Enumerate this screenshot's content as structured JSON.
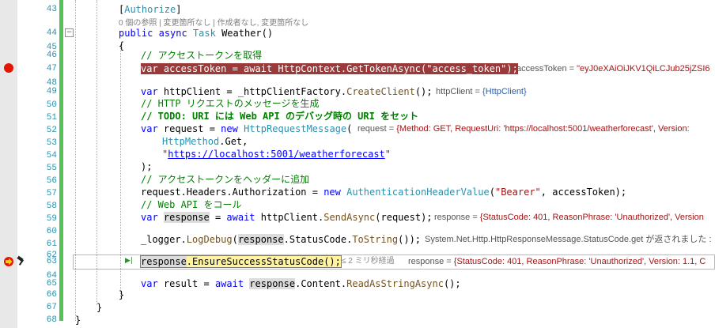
{
  "lens_text": "0 個の参照 | 変更箇所なし | 作成者なし, 変更箇所なし",
  "lines": [
    {
      "n": "43"
    },
    {
      "n": "44"
    },
    {
      "n": "45"
    },
    {
      "n": "46"
    },
    {
      "n": "47"
    },
    {
      "n": "48"
    },
    {
      "n": "49"
    },
    {
      "n": "50"
    },
    {
      "n": "51"
    },
    {
      "n": "52"
    },
    {
      "n": "53"
    },
    {
      "n": "54"
    },
    {
      "n": "55"
    },
    {
      "n": "56"
    },
    {
      "n": "57"
    },
    {
      "n": "58"
    },
    {
      "n": "59"
    },
    {
      "n": "60"
    },
    {
      "n": "61"
    },
    {
      "n": "62"
    },
    {
      "n": "63"
    },
    {
      "n": "64"
    },
    {
      "n": "65"
    },
    {
      "n": "66"
    },
    {
      "n": "67"
    },
    {
      "n": "68"
    }
  ],
  "code": {
    "l43": {
      "a": "[",
      "b": "Authorize",
      "c": "]"
    },
    "l44": {
      "kw1": "public",
      "kw2": "async",
      "ty": "Task",
      "rest": " Weather()"
    },
    "l45": "{",
    "l46": "// アクセストークンを取得",
    "l47": "var accessToken = await HttpContext.GetTokenAsync(\"access_token\");",
    "l49": {
      "kw": "var",
      "a": " httpClient = _httpClientFactory.",
      "m": "CreateClient",
      "b": "();"
    },
    "l50": "// HTTP リクエストのメッセージを生成",
    "l51": "// TODO: URI には Web API のデバッグ時の URI をセット",
    "l52": {
      "kw": "var",
      "a": " request = ",
      "kw2": "new",
      "ty": "HttpRequestMessage",
      "b": "("
    },
    "l53": {
      "ty": "HttpMethod",
      "b": ".Get,"
    },
    "l54": {
      "q1": "\"",
      "url": "https://localhost:5001/weatherforecast",
      "q2": "\""
    },
    "l55": ");",
    "l56": "// アクセストークンをヘッダーに追加",
    "l57": {
      "a": "request.Headers.Authorization = ",
      "kw": "new",
      "ty": "AuthenticationHeaderValue",
      "b": "(",
      "s": "\"Bearer\"",
      "c": ", accessToken);"
    },
    "l58": "// Web API をコール",
    "l59": {
      "kw": "var",
      "sym": "response",
      "a": " = ",
      "kw2": "await",
      "b": " httpClient.",
      "m": "SendAsync",
      "c": "(request);"
    },
    "l61": {
      "a": "_logger.",
      "m": "LogDebug",
      "b": "(",
      "sym": "response",
      "c": ".StatusCode.",
      "m2": "ToString",
      "d": "());"
    },
    "l63": {
      "sym": "response",
      "a": ".",
      "m": "EnsureSuccessStatusCode",
      "b": "();"
    },
    "l65": {
      "kw": "var",
      "a": " result = ",
      "kw2": "await",
      "b": " ",
      "sym": "response",
      "c": ".Content.",
      "m": "ReadAsStringAsync",
      "d": "();"
    },
    "l66": "}",
    "l67": "}",
    "l68": "}"
  },
  "datatips": {
    "l47": {
      "name": "accessToken = ",
      "value": "\"eyJ0eXAiOiJKV1QiLCJub25jZSI6"
    },
    "l49": {
      "name": "httpClient = ",
      "value": "{HttpClient}"
    },
    "l52": {
      "name": "request = ",
      "value": "{Method: GET, RequestUri: 'https://localhost:5001/weatherforecast', Version:"
    },
    "l59": {
      "name": "response = ",
      "value": "{StatusCode: 401, ReasonPhrase: 'Unauthorized', Version"
    },
    "l61": {
      "text": "System.Net.Http.HttpResponseMessage.StatusCode.get が返されました :"
    },
    "l63": {
      "name": "response = ",
      "value": "{StatusCode: 401, ReasonPhrase: 'Unauthorized', Version: 1.1, C"
    }
  },
  "elapsed": "≤ 2 ミリ秒経過",
  "icons": {
    "breakpoint": "breakpoint-icon",
    "current": "current-statement-arrow-icon",
    "hammer": "hammer-icon",
    "run": "run-to-click-icon"
  },
  "colors": {
    "breakpoint": "#e51400",
    "breakpoint_line": "#9b3a3a",
    "change_bar": "#55c255",
    "current_line": "#fff3a0"
  }
}
